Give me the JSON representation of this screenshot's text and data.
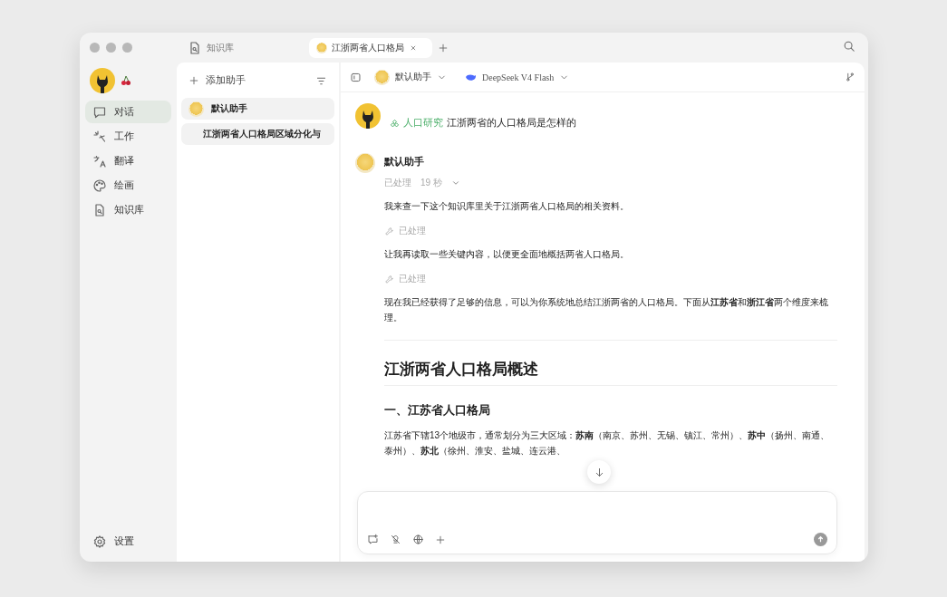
{
  "tabs": [
    {
      "label": "知识库",
      "kind": "kb",
      "selected": false
    },
    {
      "label": "江浙两省人口格局",
      "kind": "smile",
      "selected": true
    }
  ],
  "sidebar": {
    "items": [
      {
        "label": "对话",
        "kind": "chat",
        "selected": true
      },
      {
        "label": "工作",
        "kind": "spark",
        "selected": false
      },
      {
        "label": "翻译",
        "kind": "translate",
        "selected": false
      },
      {
        "label": "绘画",
        "kind": "palette",
        "selected": false
      },
      {
        "label": "知识库",
        "kind": "kb",
        "selected": false
      }
    ],
    "settings": "设置"
  },
  "assistants": {
    "add": "添加助手",
    "items": [
      {
        "label": "默认助手",
        "kind": "assistant",
        "selected": true
      },
      {
        "label": "江浙两省人口格局区域分化与",
        "kind": "topic",
        "selected": true
      }
    ]
  },
  "toolbar": {
    "assistant": "默认助手",
    "model": "DeepSeek V4 Flash"
  },
  "user_message": {
    "tag": "人口研究",
    "text": "江浙两省的人口格局是怎样的"
  },
  "reply": {
    "name": "默认助手",
    "status": "已处理",
    "duration": "19 秒",
    "blocks": [
      {
        "kind": "text",
        "text": "我来查一下这个知识库里关于江浙两省人口格局的相关资料。"
      },
      {
        "kind": "tool",
        "text": "已处理"
      },
      {
        "kind": "text",
        "text": "让我再读取一些关键内容，以便更全面地概括两省人口格局。"
      },
      {
        "kind": "tool",
        "text": "已处理"
      },
      {
        "kind": "text",
        "text": "现在我已经获得了足够的信息，可以为你系统地总结江浙两省的人口格局。下面从**江苏省**和**浙江省**两个维度来梳理。"
      },
      {
        "kind": "divider"
      },
      {
        "kind": "h1",
        "text": "江浙两省人口格局概述"
      },
      {
        "kind": "h2",
        "text": "一、江苏省人口格局"
      },
      {
        "kind": "text",
        "text": "江苏省下辖13个地级市，通常划分为三大区域：**苏南**（南京、苏州、无锡、镇江、常州）、**苏中**（扬州、南通、泰州）、**苏北**（徐州、淮安、盐城、连云港、"
      }
    ]
  }
}
